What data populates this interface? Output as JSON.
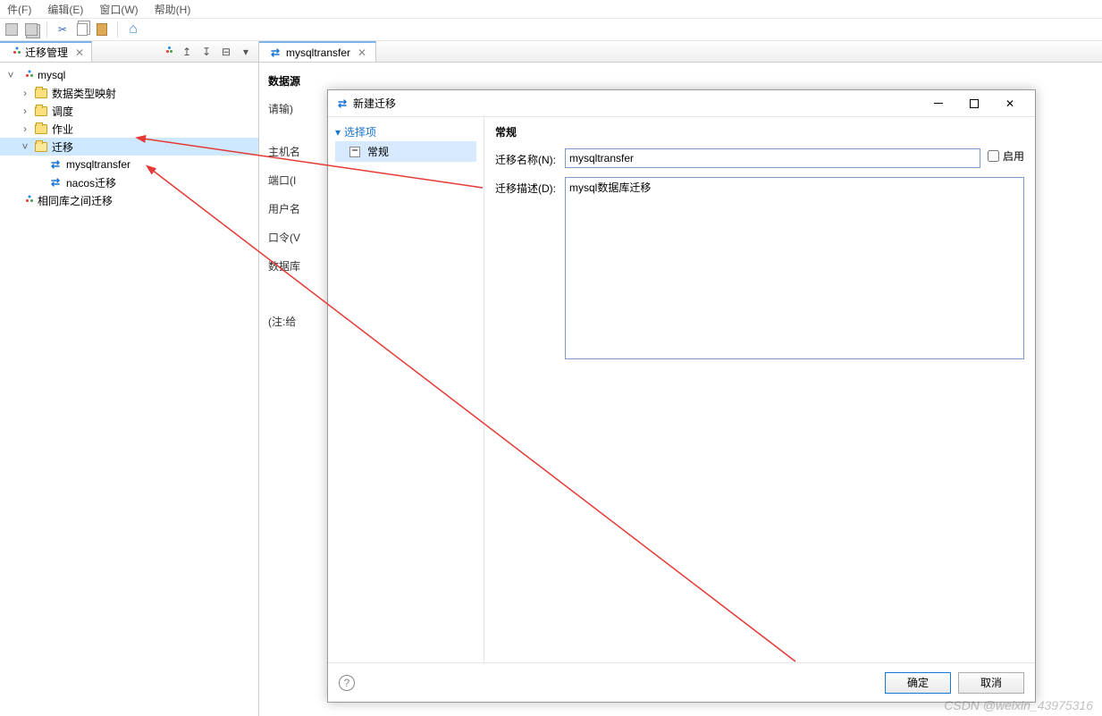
{
  "menu": {
    "file": "件(F)",
    "edit": "编辑(E)",
    "window": "窗口(W)",
    "help": "帮助(H)"
  },
  "sidebar": {
    "tab_title": "迁移管理",
    "items": [
      {
        "label": "mysql"
      },
      {
        "label": "数据类型映射"
      },
      {
        "label": "调度"
      },
      {
        "label": "作业"
      },
      {
        "label": "迁移"
      },
      {
        "label": "mysqltransfer"
      },
      {
        "label": "nacos迁移"
      },
      {
        "label": "相同库之间迁移"
      }
    ]
  },
  "editor": {
    "tab_title": "mysqltransfer",
    "section": "数据源",
    "hint": "请输)",
    "labels": {
      "host": "主机名",
      "port": "端口(I",
      "user": "用户名",
      "password": "口令(V",
      "db": "数据库",
      "note": "(注:给"
    }
  },
  "dialog": {
    "title": "新建迁移",
    "nav_header": "选择项",
    "nav_item": "常规",
    "form_title": "常规",
    "name_label": "迁移名称(N):",
    "name_value": "mysqltransfer",
    "enable_label": "启用",
    "desc_label": "迁移描述(D):",
    "desc_value": "mysql数据库迁移",
    "ok": "确定",
    "cancel": "取消",
    "help": "?"
  },
  "watermark": "CSDN @weixin_43975316"
}
